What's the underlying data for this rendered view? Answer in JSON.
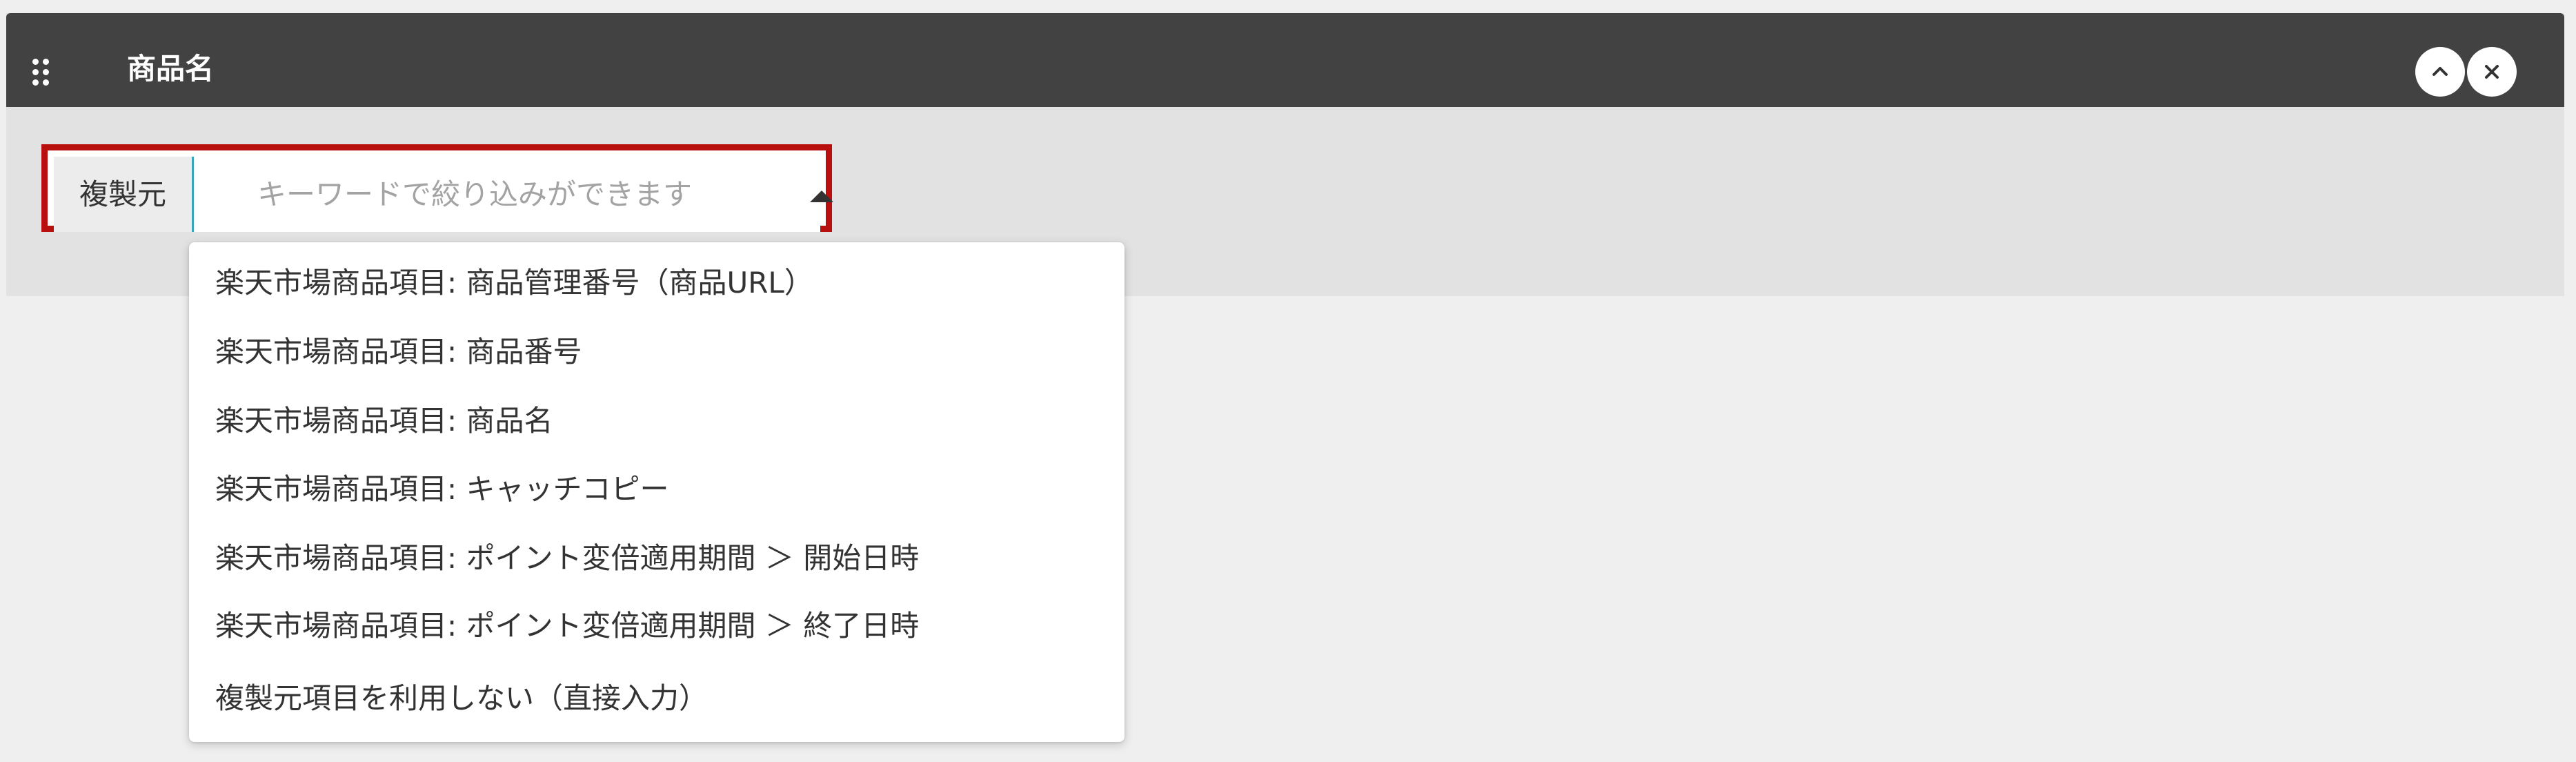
{
  "panel": {
    "title": "商品名",
    "icons": {
      "drag": "drag-handle-icon",
      "collapse": "chevron-up-icon",
      "close": "close-icon"
    }
  },
  "field": {
    "label": "複製元",
    "placeholder": "キーワードで絞り込みができます",
    "value": ""
  },
  "dropdown": {
    "items": [
      "楽天市場商品項目: 商品管理番号（商品URL）",
      "楽天市場商品項目: 商品番号",
      "楽天市場商品項目: 商品名",
      "楽天市場商品項目: キャッチコピー",
      "楽天市場商品項目: ポイント変倍適用期間 ＞ 開始日時",
      "楽天市場商品項目: ポイント変倍適用期間 ＞ 終了日時",
      "複製元項目を利用しない（直接入力）"
    ]
  },
  "colors": {
    "header_bg": "#424242",
    "panel_bg": "#e2e2e2",
    "page_bg": "#efefef",
    "highlight": "#b80f0f",
    "input_accent": "#3aa6b8"
  }
}
